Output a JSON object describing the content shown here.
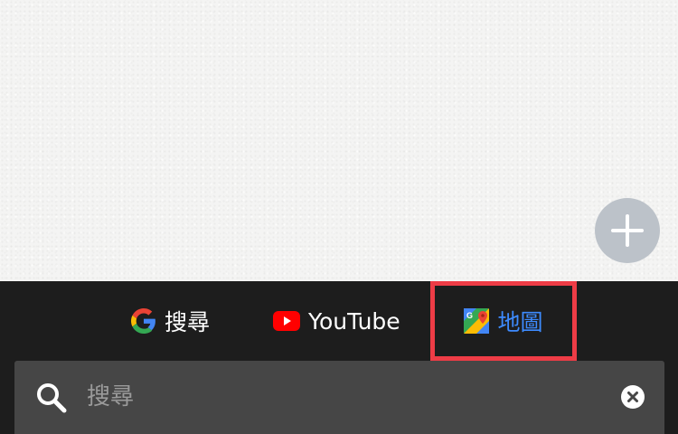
{
  "fab": {
    "icon": "plus-icon"
  },
  "tabs": [
    {
      "id": "search",
      "label": "搜尋",
      "icon": "google-g-icon",
      "selected": false
    },
    {
      "id": "youtube",
      "label": "YouTube",
      "icon": "youtube-icon",
      "selected": false
    },
    {
      "id": "maps",
      "label": "地圖",
      "icon": "google-maps-icon",
      "selected": true
    }
  ],
  "search": {
    "placeholder": "搜尋",
    "value": "",
    "icon": "search-icon",
    "clear_icon": "clear-icon"
  },
  "colors": {
    "selected_tab_text": "#3d8bff",
    "highlight_border": "#ee3c46",
    "panel_background": "#1d1d1d",
    "search_bar_background": "#464646",
    "fab_background": "#bcc2c9"
  }
}
